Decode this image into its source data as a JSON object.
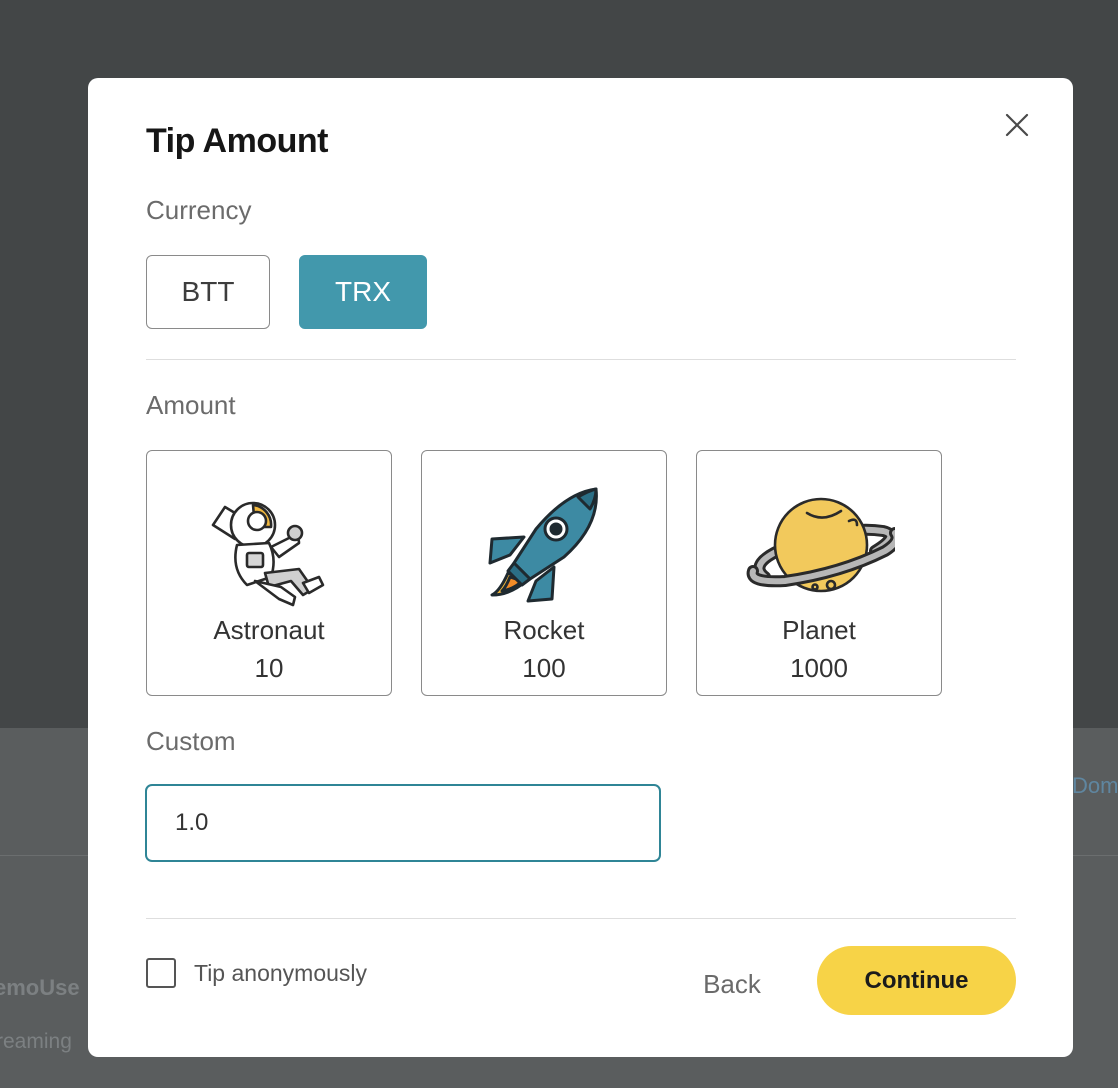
{
  "background": {
    "username_fragment": "emoUse",
    "streaming_fragment": "reaming",
    "domain_fragment": "Dom"
  },
  "modal": {
    "title": "Tip Amount",
    "close_icon": "close-icon"
  },
  "currency": {
    "label": "Currency",
    "options": [
      {
        "label": "BTT",
        "selected": false
      },
      {
        "label": "TRX",
        "selected": true
      }
    ],
    "selected_color": "#4298ac"
  },
  "amount": {
    "label": "Amount",
    "presets": [
      {
        "name": "Astronaut",
        "value": "10",
        "icon": "astronaut-icon"
      },
      {
        "name": "Rocket",
        "value": "100",
        "icon": "rocket-icon"
      },
      {
        "name": "Planet",
        "value": "1000",
        "icon": "planet-icon"
      }
    ]
  },
  "custom": {
    "label": "Custom",
    "value": "1.0",
    "border_color": "#2f8596"
  },
  "footer": {
    "anonymous_label": "Tip anonymously",
    "anonymous_checked": false,
    "back_label": "Back",
    "continue_label": "Continue",
    "continue_color": "#f7d347"
  }
}
